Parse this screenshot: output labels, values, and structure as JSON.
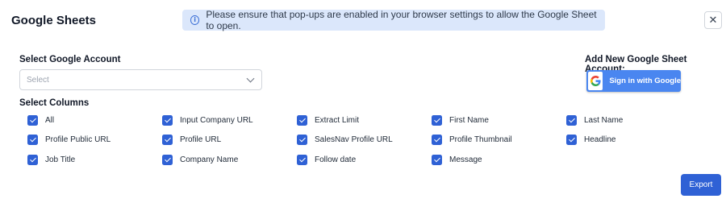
{
  "header": {
    "title": "Google Sheets",
    "notice": "Please ensure that pop-ups are enabled in your browser settings to allow the Google Sheet to open.",
    "notice_icon": "info-icon",
    "close_icon": "close-icon",
    "close_symbol": "✕"
  },
  "account": {
    "label": "Select Google Account",
    "placeholder": "Select",
    "add_label": "Add New Google Sheet Account:",
    "signin_label": "Sign in with Google"
  },
  "columns": {
    "label": "Select Columns",
    "items": [
      {
        "label": "All",
        "checked": true
      },
      {
        "label": "Input Company URL",
        "checked": true
      },
      {
        "label": "Extract Limit",
        "checked": true
      },
      {
        "label": "First Name",
        "checked": true
      },
      {
        "label": "Last Name",
        "checked": true
      },
      {
        "label": "Profile Public URL",
        "checked": true
      },
      {
        "label": "Profile URL",
        "checked": true
      },
      {
        "label": "SalesNav Profile URL",
        "checked": true
      },
      {
        "label": "Profile Thumbnail",
        "checked": true
      },
      {
        "label": "Headline",
        "checked": true
      },
      {
        "label": "Job Title",
        "checked": true
      },
      {
        "label": "Company Name",
        "checked": true
      },
      {
        "label": "Follow date",
        "checked": true
      },
      {
        "label": "Message",
        "checked": true
      }
    ]
  },
  "footer": {
    "export_label": "Export"
  },
  "colors": {
    "accent": "#2f61d5",
    "google_button": "#4a86f0",
    "notice_bg": "#dbe7fb"
  }
}
